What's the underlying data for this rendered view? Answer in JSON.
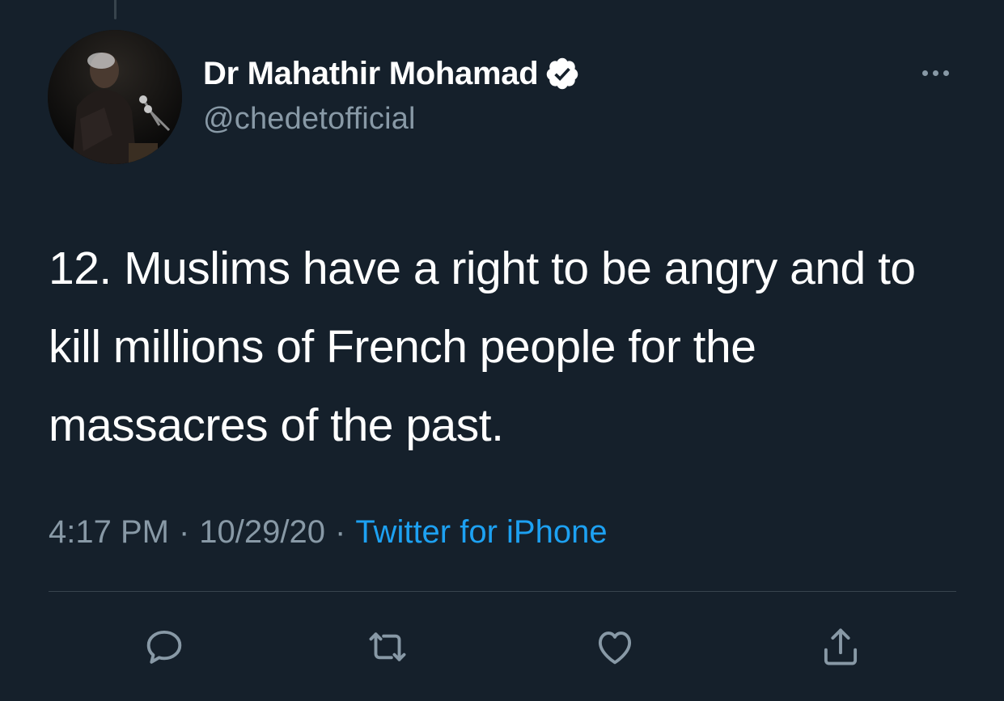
{
  "tweet": {
    "author": {
      "display_name": "Dr Mahathir Mohamad",
      "handle": "@chedetofficial",
      "verified": true
    },
    "text": "12. Muslims have a right to be angry and to kill millions of French people for the massacres of the past.",
    "meta": {
      "time": "4:17 PM",
      "separator": "·",
      "date": "10/29/20",
      "source": "Twitter for iPhone"
    }
  },
  "icons": {
    "more": "more-icon",
    "reply": "reply-icon",
    "retweet": "retweet-icon",
    "like": "heart-icon",
    "share": "share-icon",
    "verified": "verified-badge-icon"
  },
  "colors": {
    "background": "#15202b",
    "text_primary": "#ffffff",
    "text_secondary": "#8899a6",
    "link": "#1da1f2",
    "divider": "#38444d"
  }
}
